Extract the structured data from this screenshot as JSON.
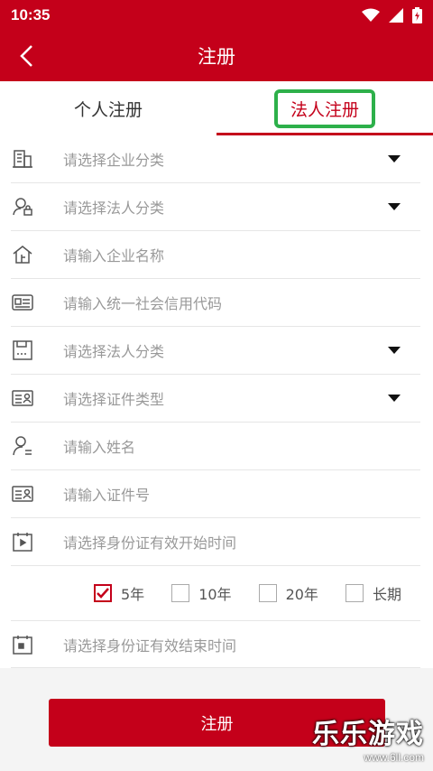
{
  "status": {
    "time": "10:35"
  },
  "header": {
    "title": "注册"
  },
  "tabs": [
    {
      "label": "个人注册"
    },
    {
      "label": "法人注册"
    }
  ],
  "form": {
    "rows": [
      {
        "placeholder": "请选择企业分类",
        "icon": "building-icon"
      },
      {
        "placeholder": "请选择法人分类",
        "icon": "person-lock-icon"
      },
      {
        "placeholder": "请输入企业名称",
        "icon": "home-icon"
      },
      {
        "placeholder": "请输入统一社会信用代码",
        "icon": "id-card-icon"
      },
      {
        "placeholder": "请选择法人分类",
        "icon": "save-icon"
      },
      {
        "placeholder": "请选择证件类型",
        "icon": "id-card-icon"
      },
      {
        "placeholder": "请输入姓名",
        "icon": "person-icon"
      },
      {
        "placeholder": "请输入证件号",
        "icon": "id-card-icon"
      },
      {
        "placeholder": "请选择身份证有效开始时间",
        "icon": "calendar-icon"
      },
      {
        "placeholder": "请选择身份证有效结束时间",
        "icon": "calendar-icon"
      }
    ],
    "validity_options": [
      {
        "label": "5年",
        "checked": true
      },
      {
        "label": "10年",
        "checked": false
      },
      {
        "label": "20年",
        "checked": false
      },
      {
        "label": "长期",
        "checked": false
      }
    ]
  },
  "footer": {
    "register_label": "注册"
  },
  "watermark": {
    "text": "乐乐游戏",
    "url": "www.6ll.com"
  },
  "colors": {
    "brand": "#c4001a",
    "highlight": "#2db04a"
  }
}
